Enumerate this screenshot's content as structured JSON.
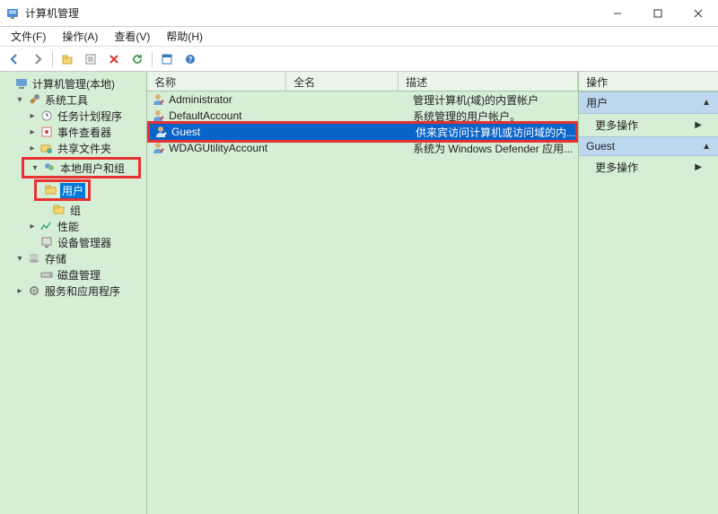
{
  "window": {
    "title": "计算机管理"
  },
  "menu": {
    "file": "文件(F)",
    "action": "操作(A)",
    "view": "查看(V)",
    "help": "帮助(H)"
  },
  "tree": {
    "root": "计算机管理(本地)",
    "system_tools": "系统工具",
    "task_scheduler": "任务计划程序",
    "event_viewer": "事件查看器",
    "shared_folders": "共享文件夹",
    "local_users": "本地用户和组",
    "users": "用户",
    "groups": "组",
    "performance": "性能",
    "device_manager": "设备管理器",
    "storage": "存储",
    "disk_management": "磁盘管理",
    "services_apps": "服务和应用程序"
  },
  "list": {
    "columns": {
      "name": "名称",
      "fullname": "全名",
      "desc": "描述"
    },
    "rows": [
      {
        "name": "Administrator",
        "fullname": "",
        "desc": "管理计算机(域)的内置帐户"
      },
      {
        "name": "DefaultAccount",
        "fullname": "",
        "desc": "系统管理的用户帐户。"
      },
      {
        "name": "Guest",
        "fullname": "",
        "desc": "供来宾访问计算机或访问域的内..."
      },
      {
        "name": "WDAGUtilityAccount",
        "fullname": "",
        "desc": "系统为 Windows Defender 应用..."
      }
    ]
  },
  "actions": {
    "header": "操作",
    "section_users": "用户",
    "more_ops": "更多操作",
    "section_guest": "Guest"
  }
}
